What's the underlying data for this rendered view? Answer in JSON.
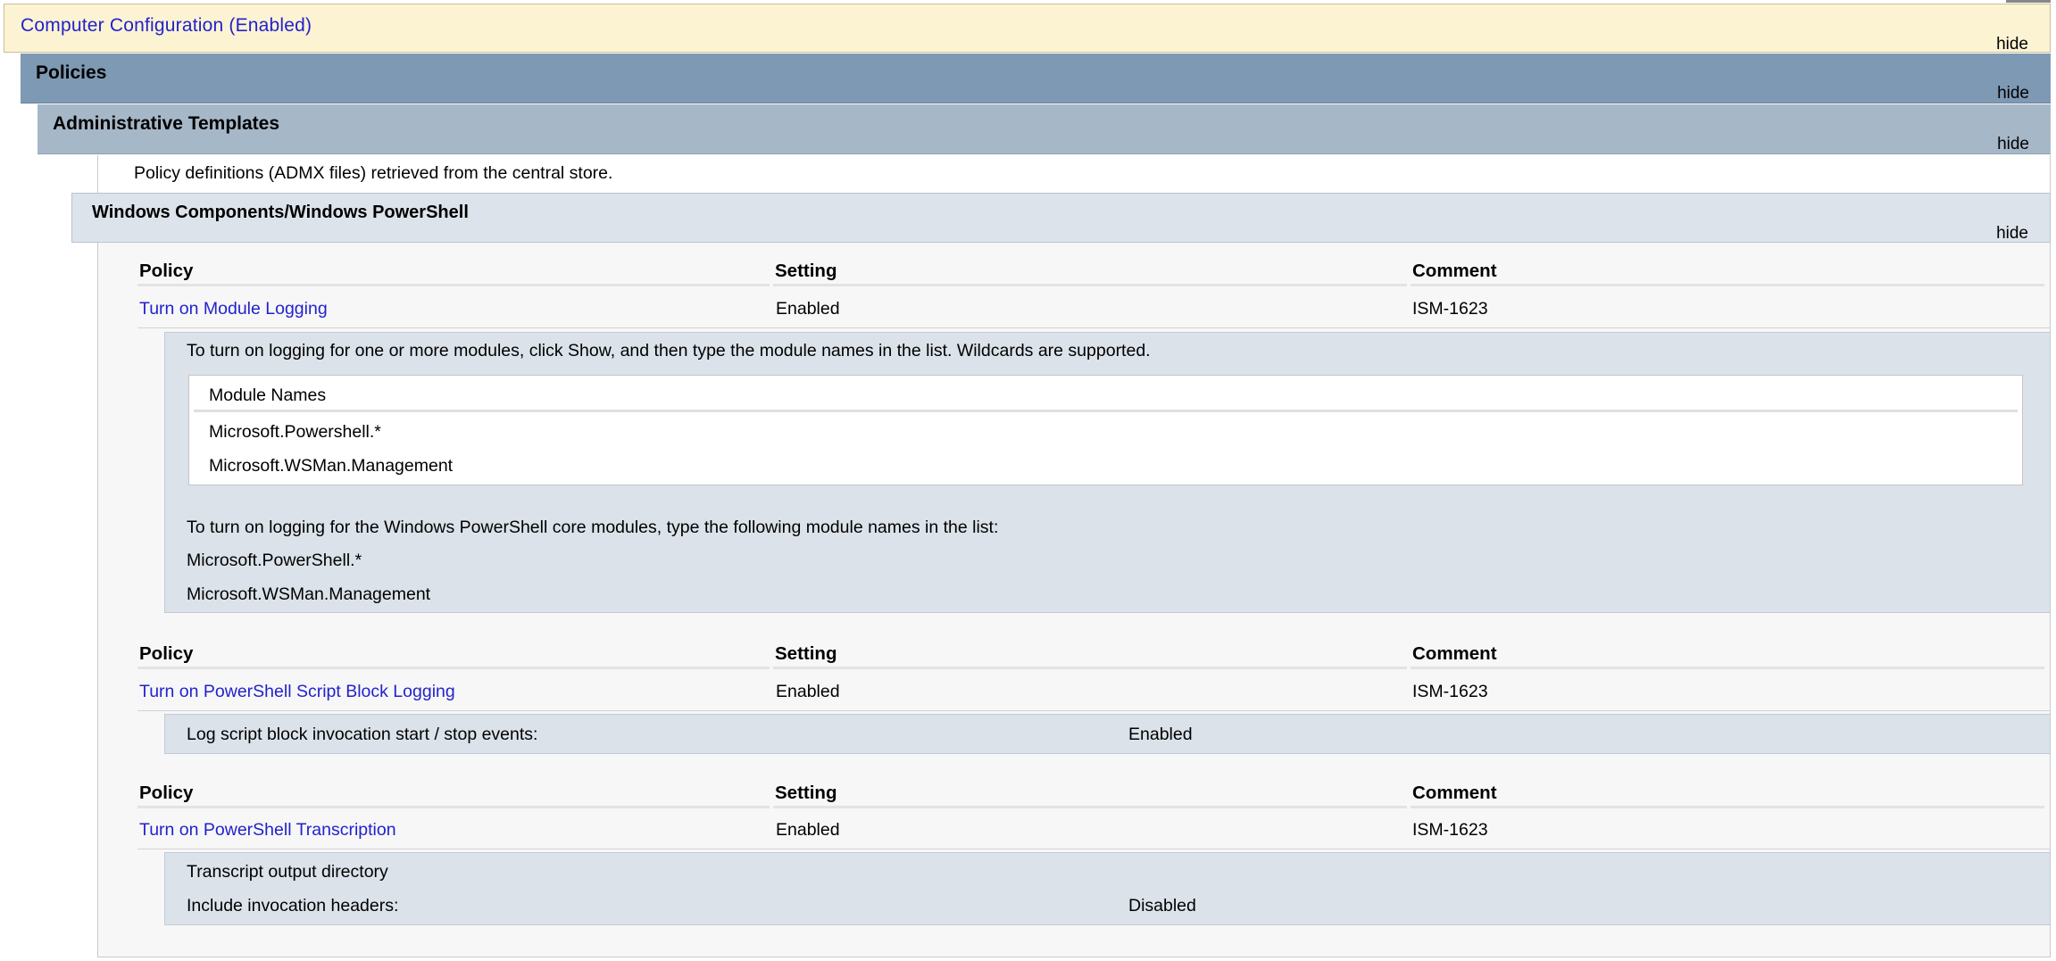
{
  "computer_configuration": {
    "title": "Computer Configuration (Enabled)",
    "hide_label": "hide"
  },
  "policies": {
    "title": "Policies",
    "hide_label": "hide"
  },
  "admin_templates": {
    "title": "Administrative Templates",
    "hide_label": "hide",
    "note": "Policy definitions (ADMX files) retrieved from the central store."
  },
  "windows_components": {
    "title": "Windows Components/Windows PowerShell",
    "hide_label": "hide"
  },
  "column_headers": {
    "policy": "Policy",
    "setting": "Setting",
    "comment": "Comment"
  },
  "policy_rows": [
    {
      "name": "Turn on Module Logging",
      "setting": "Enabled",
      "comment": "ISM-1623",
      "details": {
        "intro": "To turn on logging for one or more modules, click Show, and then type the module names in the list. Wildcards are supported.",
        "table_header": "Module Names",
        "modules": [
          "Microsoft.Powershell.*",
          "Microsoft.WSMan.Management"
        ],
        "core_note": "To turn on logging for the Windows PowerShell core modules, type the following module names in the list:",
        "core_modules": [
          "Microsoft.PowerShell.*",
          "Microsoft.WSMan.Management"
        ]
      }
    },
    {
      "name": "Turn on PowerShell Script Block Logging",
      "setting": "Enabled",
      "comment": "ISM-1623",
      "details": {
        "label": "Log script block invocation start / stop events:",
        "value": "Enabled"
      }
    },
    {
      "name": "Turn on PowerShell Transcription",
      "setting": "Enabled",
      "comment": "ISM-1623",
      "details": {
        "row1_label": "Transcript output directory",
        "row2_label": "Include invocation headers:",
        "row2_value": "Disabled"
      }
    }
  ]
}
